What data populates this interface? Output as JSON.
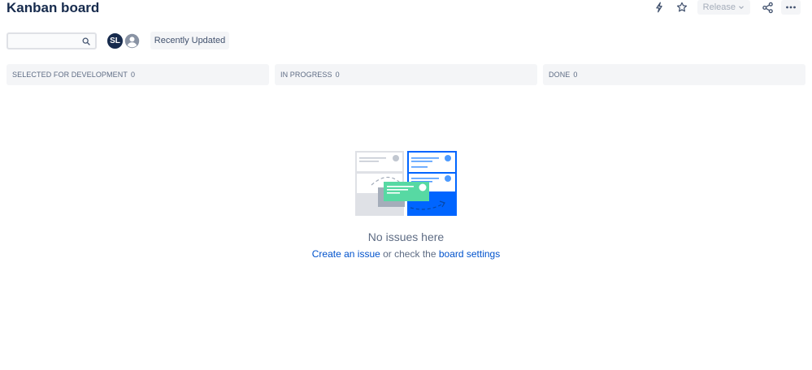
{
  "header": {
    "title": "Kanban board",
    "release_label": "Release"
  },
  "filters": {
    "search_placeholder": "",
    "search_value": "",
    "avatar_initials": "SL",
    "recently_updated_label": "Recently Updated"
  },
  "columns": [
    {
      "name": "SELECTED FOR DEVELOPMENT",
      "count": "0"
    },
    {
      "name": "IN PROGRESS",
      "count": "0"
    },
    {
      "name": "DONE",
      "count": "0"
    }
  ],
  "empty_state": {
    "title": "No issues here",
    "create_link": "Create an issue",
    "middle_text": " or check the ",
    "settings_link": "board settings"
  },
  "colors": {
    "title": "#172b4d",
    "link": "#0052cc",
    "column_bg": "#f4f5f7",
    "muted_text": "#5e6c84",
    "illustration_blue": "#0065ff",
    "illustration_green": "#57d9a3"
  },
  "icons": [
    "lightning-icon",
    "star-icon",
    "chevron-down-icon",
    "share-icon",
    "more-icon",
    "search-icon",
    "user-icon"
  ]
}
